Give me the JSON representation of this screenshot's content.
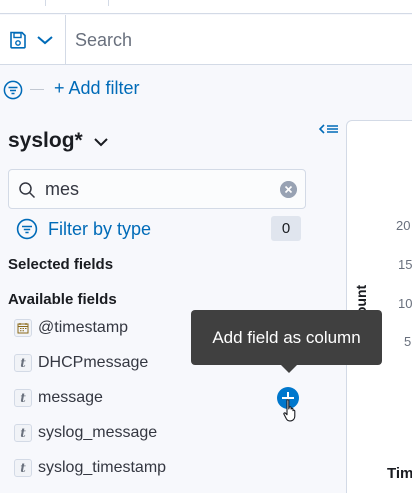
{
  "search": {
    "placeholder": "Search",
    "value": ""
  },
  "filters": {
    "add_label": "+ Add filter"
  },
  "sidebar": {
    "index_pattern": "syslog*",
    "field_search_value": "mes",
    "filter_by_type_label": "Filter by type",
    "filter_count": "0",
    "selected_fields_title": "Selected fields",
    "available_fields_title": "Available fields",
    "available_fields": [
      {
        "name": "@timestamp",
        "type": "date"
      },
      {
        "name": "DHCPmessage",
        "type": "t"
      },
      {
        "name": "message",
        "type": "t"
      },
      {
        "name": "syslog_message",
        "type": "t"
      },
      {
        "name": "syslog_timestamp",
        "type": "t"
      }
    ]
  },
  "tooltip": {
    "text": "Add field as column"
  },
  "chart": {
    "ylabel_visible": "ount",
    "xlabel_visible": "Tim",
    "y_ticks": [
      "20",
      "15",
      "10",
      "5"
    ]
  },
  "colors": {
    "accent": "#006bb8",
    "add_button": "#0077cc",
    "tooltip_bg": "#404040",
    "page_bg": "#f7f8fc"
  },
  "icons": {
    "save": "save-icon",
    "filter_menu": "filter-menu-icon",
    "collapse": "collapse-sidebar-icon",
    "search": "search-icon",
    "clear": "clear-icon",
    "filter_type": "filter-icon",
    "date_token": "calendar-icon",
    "string_token": "string-type-icon",
    "add": "plus-icon",
    "cursor": "pointer-hand-icon"
  }
}
